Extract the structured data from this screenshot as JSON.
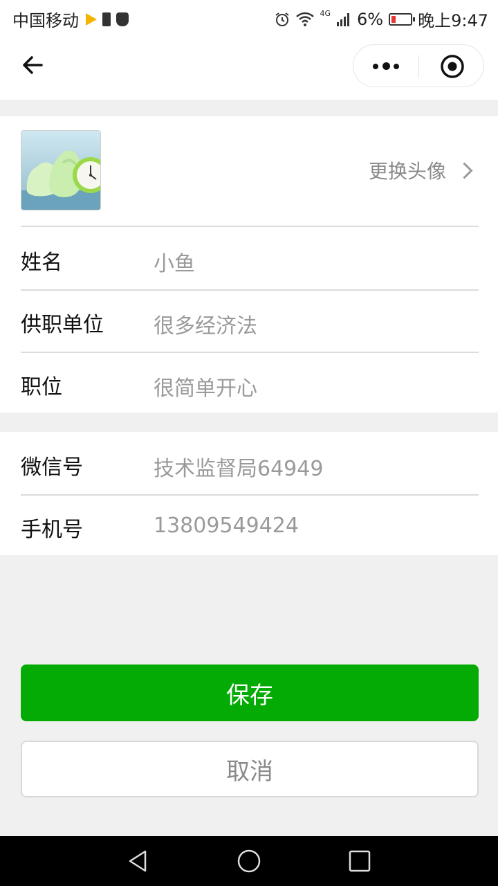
{
  "status_bar": {
    "carrier": "中国移动",
    "network": "4G",
    "battery": "6%",
    "time": "晚上9:47",
    "icons": [
      "video-play-icon",
      "phone-alert-icon",
      "shield-icon",
      "alarm-icon",
      "wifi-icon",
      "signal-icon",
      "battery-low-icon"
    ]
  },
  "nav": {
    "icons": [
      "back-arrow-icon",
      "more-dots-icon",
      "close-target-icon"
    ]
  },
  "profile": {
    "change_avatar_label": "更换头像",
    "fields_group1": [
      {
        "label": "姓名",
        "value": "小鱼"
      },
      {
        "label": "供职单位",
        "value": "很多经济法"
      },
      {
        "label": "职位",
        "value": "很简单开心"
      }
    ],
    "fields_group2": [
      {
        "label": "微信号",
        "value": "技术监督局64949"
      },
      {
        "label": "手机号",
        "value": "13809549424"
      }
    ]
  },
  "actions": {
    "save_label": "保存",
    "cancel_label": "取消"
  },
  "colors": {
    "primary_green": "#04ab04",
    "background": "#f0f0f0",
    "value_gray": "#9a9a9a"
  }
}
